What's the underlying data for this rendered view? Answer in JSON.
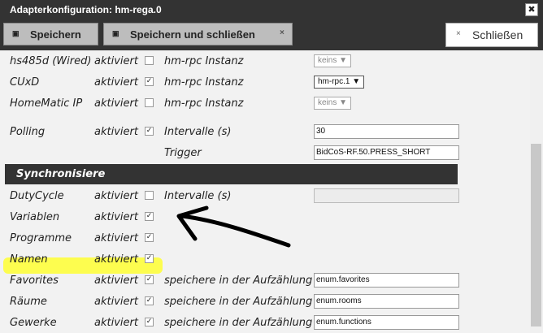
{
  "window": {
    "title": "Adapterkonfiguration: hm-rega.0",
    "close_glyph": "✖"
  },
  "toolbar": {
    "save_label": "Speichern",
    "save_close_label": "Speichern und schließen",
    "close_label": "Schließen",
    "dismiss_glyph": "×",
    "disk_glyph": "▣"
  },
  "rows": [
    {
      "name": "hs485d (Wired)",
      "status": "aktiviert",
      "checked": "",
      "setting": "hm-rpc Instanz",
      "select": "keins ▼"
    },
    {
      "name": "CUxD",
      "status": "aktiviert",
      "checked": "✓",
      "setting": "hm-rpc Instanz",
      "select": "hm-rpc.1 ▼"
    },
    {
      "name": "HomeMatic IP",
      "status": "aktiviert",
      "checked": "",
      "setting": "hm-rpc Instanz",
      "select": "keins ▼"
    },
    {
      "name": "Polling",
      "status": "aktiviert",
      "checked": "✓",
      "setting": "Intervalle (s)",
      "value": "30"
    },
    {
      "setting": "Trigger",
      "value": "BidCoS-RF.50.PRESS_SHORT"
    }
  ],
  "section": {
    "label": "Synchronisiere"
  },
  "sync_rows": [
    {
      "name": "DutyCycle",
      "status": "aktiviert",
      "checked": "",
      "setting": "Intervalle (s)",
      "value": ""
    },
    {
      "name": "Variablen",
      "status": "aktiviert",
      "checked": "✓"
    },
    {
      "name": "Programme",
      "status": "aktiviert",
      "checked": "✓"
    },
    {
      "name": "Namen",
      "status": "aktiviert",
      "checked": "✓"
    },
    {
      "name": "Favorites",
      "status": "aktiviert",
      "checked": "✓",
      "setting": "speichere in der Aufzählung",
      "value": "enum.favorites"
    },
    {
      "name": "Räume",
      "status": "aktiviert",
      "checked": "✓",
      "setting": "speichere in der Aufzählung",
      "value": "enum.rooms"
    },
    {
      "name": "Gewerke",
      "status": "aktiviert",
      "checked": "✓",
      "setting": "speichere in der Aufzählung",
      "value": "enum.functions"
    }
  ],
  "annotation": {
    "highlight_color": "#ffff33",
    "arrow_color": "#000000"
  }
}
